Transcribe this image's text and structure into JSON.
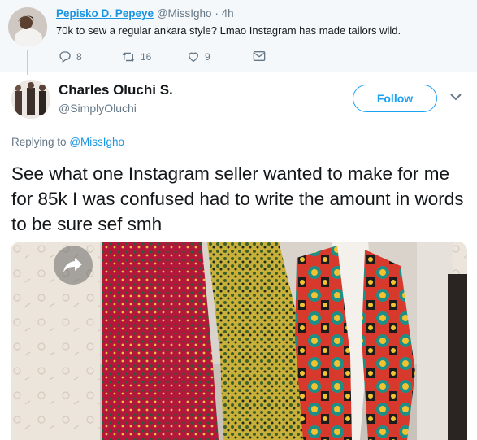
{
  "parent_tweet": {
    "display_name": "Pepisko D. Pepeye",
    "handle": "@MissIgho",
    "time": "· 4h",
    "text": "70k to sew a regular ankara style? Lmao Instagram has made tailors wild.",
    "replies": "8",
    "retweets": "16",
    "likes": "9"
  },
  "main_tweet": {
    "display_name": "Charles Oluchi S.",
    "handle": "@SimplyOluchi",
    "follow_label": "Follow",
    "replying_prefix": "Replying to",
    "replying_to": "@MissIgho",
    "text": "See what one Instagram seller wanted to make for me for 85k I was confused had to write the amount in words to be sure sef smh"
  },
  "icons": [
    "reply-icon",
    "retweet-icon",
    "like-icon",
    "dm-icon",
    "chevron-down-icon",
    "share-arrow-icon"
  ],
  "colors": {
    "accent": "#1da1f2",
    "link": "#1b95e0",
    "muted": "#657786",
    "text": "#14171a",
    "thread": "#a8d8f0"
  }
}
